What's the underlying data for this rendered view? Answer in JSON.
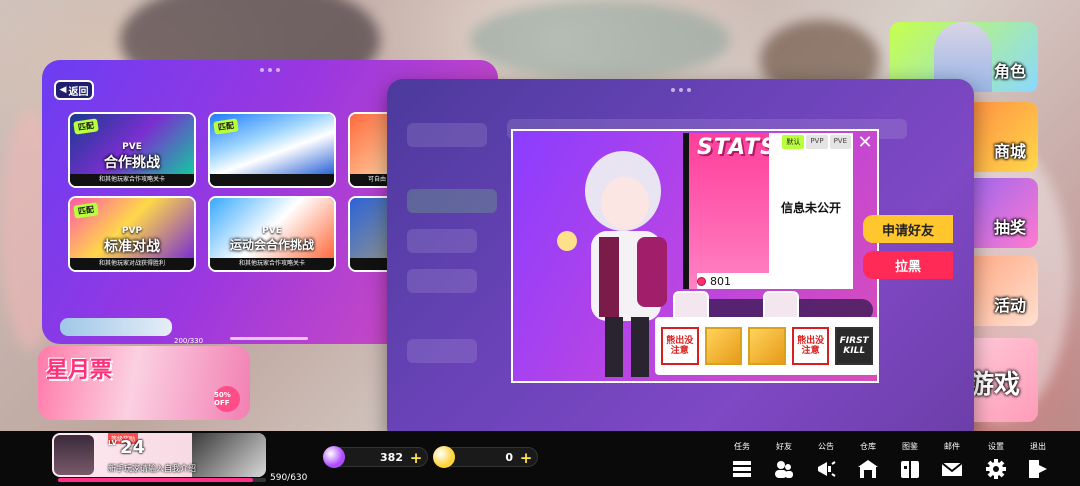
{
  "left_panel": {
    "back_label": "返回",
    "modes": [
      {
        "tag": "匹配",
        "kind": "PVE",
        "name": "合作挑战",
        "desc": "和其他玩家合作攻略关卡"
      },
      {
        "tag": "匹配",
        "kind": "",
        "name": "",
        "desc": ""
      },
      {
        "tag": "",
        "kind": "",
        "name": "",
        "desc": "可自由"
      },
      {
        "tag": "匹配",
        "kind": "PVP",
        "name": "标准对战",
        "desc": "和其他玩家对战获得胜利"
      },
      {
        "tag": "",
        "kind": "PVE",
        "name": "运动会合作挑战",
        "desc": "和其他玩家合作攻略关卡"
      },
      {
        "tag": "",
        "kind": "",
        "name": "",
        "desc": ""
      }
    ],
    "progress_text": "200/330"
  },
  "monthly": {
    "title": "星月票",
    "badge": "50% OFF"
  },
  "side_menu": {
    "role": "角色",
    "shop": "商城",
    "gacha": "抽奖",
    "event": "活动",
    "game": "游戏"
  },
  "profile": {
    "stats_title": "STATS",
    "tabs": [
      "默认",
      "PVP",
      "PVE"
    ],
    "message": "信息未公开",
    "coins": "801",
    "add_friend": "申请好友",
    "block": "拉黑",
    "badges": [
      {
        "text": "熊出没注意",
        "style": "red"
      },
      {
        "text": "",
        "style": "gold"
      },
      {
        "text": "",
        "style": "gold"
      },
      {
        "text": "熊出没注意",
        "style": "red"
      },
      {
        "text": "FIRST KILL",
        "style": "dark"
      }
    ]
  },
  "player": {
    "tag": "等级奖励",
    "lv_label": "LV",
    "level": "24",
    "signature": "新手玩家请输入自我介绍",
    "exp_text": "590/630",
    "exp_fraction": 0.936
  },
  "currency": [
    {
      "value": "382",
      "color": "#b04cff"
    },
    {
      "value": "0",
      "color": "#ffd43a"
    }
  ],
  "nav": [
    {
      "label": "任务",
      "icon": "task-list-icon"
    },
    {
      "label": "好友",
      "icon": "friends-icon"
    },
    {
      "label": "公告",
      "icon": "megaphone-icon"
    },
    {
      "label": "仓库",
      "icon": "warehouse-icon"
    },
    {
      "label": "图鉴",
      "icon": "book-icon"
    },
    {
      "label": "邮件",
      "icon": "mail-icon"
    },
    {
      "label": "设置",
      "icon": "gear-icon"
    },
    {
      "label": "退出",
      "icon": "exit-icon"
    }
  ]
}
